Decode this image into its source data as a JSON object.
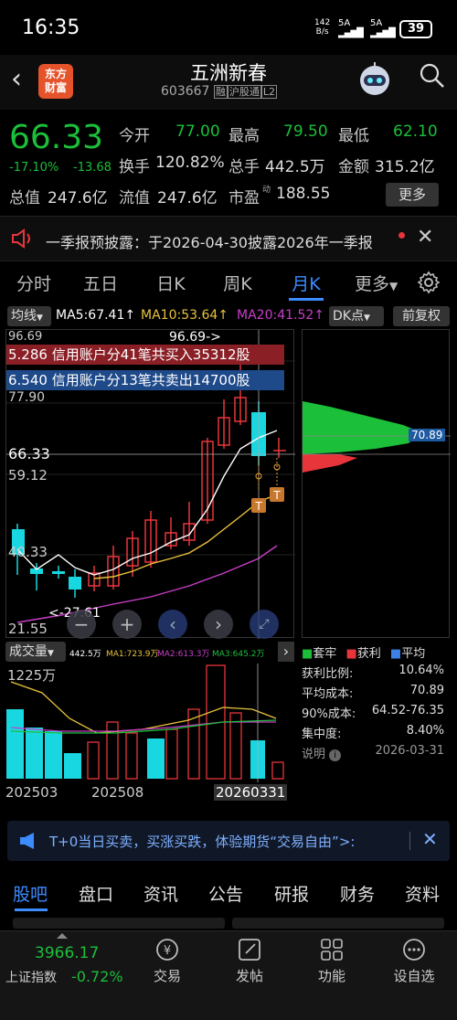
{
  "status": {
    "time": "16:35",
    "net_speed_top": "142",
    "net_speed_bottom": "B/s",
    "sig1": "5A",
    "sig2": "5A",
    "battery": "39"
  },
  "header": {
    "logo_line1": "东方",
    "logo_line2": "财富",
    "title": "五洲新春",
    "code": "603667",
    "tag1": "融",
    "tag2": "沪股通",
    "tag3": "L2"
  },
  "quote": {
    "price": "66.33",
    "pct": "-17.10%",
    "chg": "-13.68",
    "open_label": "今开",
    "open": "77.00",
    "high_label": "最高",
    "high": "79.50",
    "low_label": "最低",
    "low": "62.10",
    "turnover_label": "换手",
    "turnover": "120.82%",
    "vol_label": "总手",
    "vol": "442.5万",
    "amount_label": "金额",
    "amount": "315.2亿",
    "mcap_label": "总值",
    "mcap": "247.6亿",
    "float_label": "流值",
    "float": "247.6亿",
    "pe_label": "市盈",
    "pe_sup": "动",
    "pe": "188.55",
    "more": "更多"
  },
  "notice": {
    "text": "一季报预披露：于2026-04-30披露2026年一季报"
  },
  "tabs": [
    "分时",
    "五日",
    "日K",
    "周K",
    "月K",
    "更多"
  ],
  "active_tab": 4,
  "indicator": {
    "ma_btn": "均线",
    "ma5": "MA5:67.41↑",
    "ma10": "MA10:53.64↑",
    "ma20": "MA20:41.52↑",
    "dk_btn": "DK点",
    "adj_btn": "前复权"
  },
  "chart": {
    "yticks": [
      "96.69",
      "77.90",
      "66.33",
      "59.12",
      "40.33",
      "21.55"
    ],
    "banner1": "5.286  信用账户分41笔共买入35312股",
    "banner2": "6.540  信用账户分13笔共卖出14700股",
    "annot_high": "96.69->",
    "annot_low": "<-27.61",
    "dist_price": "70.89"
  },
  "volume": {
    "btn": "成交量",
    "v_label": "442.5万",
    "ma1": "MA1:723.9万",
    "ma2": "MA2:613.3万",
    "ma3": "MA3:645.2万",
    "ytick": "1225万",
    "dates": [
      "202503",
      "202508",
      "20260331"
    ]
  },
  "stats": {
    "legend": [
      "套牢",
      "获利",
      "平均"
    ],
    "rows": [
      {
        "k": "获利比例:",
        "v": "10.64%"
      },
      {
        "k": "平均成本:",
        "v": "70.89"
      },
      {
        "k": "90%成本:",
        "v": "64.52-76.35"
      },
      {
        "k": "集中度:",
        "v": "8.40%"
      },
      {
        "k": "说明",
        "v": "2026-03-31"
      }
    ]
  },
  "ad": {
    "text": "T+0当日买卖，买涨买跌，体验期货“交易自由”>:"
  },
  "bottom_tabs": [
    "股吧",
    "盘口",
    "资讯",
    "公告",
    "研报",
    "财务",
    "资料"
  ],
  "footer": {
    "index_value": "3966.17",
    "index_name": "上证指数",
    "index_pct": "-0.72%",
    "items": [
      "交易",
      "发帖",
      "功能",
      "设自选"
    ]
  },
  "colors": {
    "up": "#e8353b",
    "down": "#18d7e0",
    "profit": "#e8353b",
    "trapped": "#1bbf3a",
    "ma5": "#ffffff",
    "ma10": "#e8c23c",
    "ma20": "#c93ec9"
  }
}
